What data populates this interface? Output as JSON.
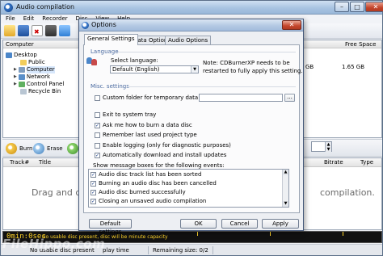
{
  "window": {
    "title": "Audio compilation"
  },
  "menu": [
    "File",
    "Edit",
    "Recorder",
    "Disc",
    "View",
    "Help"
  ],
  "left_pane": {
    "header": "Computer",
    "tree": [
      {
        "label": "Desktop",
        "icon": "desktop-icon"
      },
      {
        "label": "Public",
        "icon": "folder-icon"
      },
      {
        "label": "Computer",
        "icon": "computer-icon",
        "selected": true
      },
      {
        "label": "Network",
        "icon": "network-icon"
      },
      {
        "label": "Control Panel",
        "icon": "control-panel-icon"
      },
      {
        "label": "Recycle Bin",
        "icon": "recycle-bin-icon"
      }
    ]
  },
  "right_pane": {
    "col_free_space": "Free Space",
    "cell_gb": "GB",
    "cell_free": "1.65 GB"
  },
  "burn_bar": {
    "burn_label": "Burn",
    "erase_label": "Erase"
  },
  "tracklist": {
    "col_track": "Track#",
    "col_title": "Title",
    "col_bitrate": "Bitrate",
    "col_type": "Type",
    "hint_left": "Drag and dr",
    "hint_right": "compilation."
  },
  "progress": {
    "time": "0min:0sec",
    "warning": "No usable disc present, disc will be minute capacity"
  },
  "statusbar": {
    "disc_info": "No usable disc present",
    "play_time": "play time",
    "remaining": "Remaining size: 0/2"
  },
  "watermark": "FileHippo.com",
  "dialog": {
    "title": "Options",
    "tabs": [
      "General Settings",
      "Data Options",
      "Audio Options"
    ],
    "language_group": "Language",
    "select_language_label": "Select language:",
    "language_value": "Default (English)",
    "language_note_1": "Note: CDBurnerXP needs to be",
    "language_note_2": "restarted to fully apply this setting.",
    "misc_group": "Misc. settings",
    "custom_folder_label": "Custom folder for temporary data:",
    "browse_label": "...",
    "checkboxes": [
      {
        "label": "Exit to system tray",
        "checked": false
      },
      {
        "label": "Ask me how to burn a data disc",
        "checked": true
      },
      {
        "label": "Remember last used project type",
        "checked": false
      },
      {
        "label": "Enable logging (only for diagnostic purposes)",
        "checked": false
      },
      {
        "label": "Automatically download and install updates",
        "checked": true
      }
    ],
    "events_label": "Show message boxes for the following events:",
    "events": [
      {
        "label": "Audio disc track list has been sorted",
        "checked": true
      },
      {
        "label": "Burning an audio disc has been cancelled",
        "checked": true
      },
      {
        "label": "Audio disc burned successfully",
        "checked": true
      },
      {
        "label": "Closing an unsaved audio compilation",
        "checked": true
      }
    ],
    "buttons": {
      "default": "Default settings",
      "ok": "OK",
      "cancel": "Cancel",
      "apply": "Apply"
    }
  },
  "colors": {
    "accent": "#3a7bd0",
    "progress_text": "#ffd42a"
  }
}
